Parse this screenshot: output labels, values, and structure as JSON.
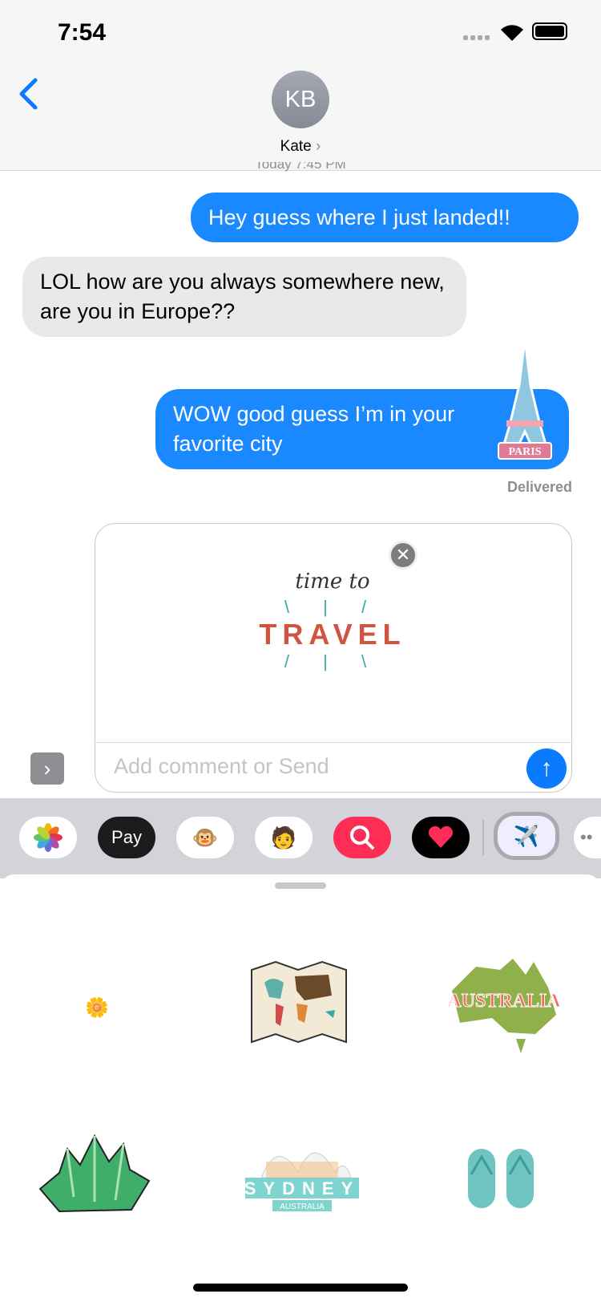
{
  "status": {
    "time": "7:54"
  },
  "header": {
    "avatar_initials": "KB",
    "contact_name": "Kate",
    "contact_chevron": "›"
  },
  "thread": {
    "timestamp": "Today 7:45 PM",
    "messages": [
      {
        "from": "me",
        "text": "Hey guess where I just landed!!"
      },
      {
        "from": "them",
        "text": "LOL how are you always somewhere new, are you in Europe??"
      },
      {
        "from": "me",
        "text": "WOW good guess I’m in your favorite city",
        "sticker": "PARIS"
      }
    ],
    "delivered": "Delivered"
  },
  "compose": {
    "sticker_line1": "time to",
    "sticker_line2": "TRAVEL",
    "placeholder": "Add comment or Send"
  },
  "apps": [
    "photos",
    "apple-pay",
    "animoji",
    "memoji",
    "image-search",
    "digital-touch",
    "travel-stickers",
    "more"
  ],
  "apps_labels": {
    "applepay": "Pay"
  },
  "stickers": {
    "australia": "AUSTRALIA",
    "sydney": "SYDNEY",
    "sydney_sub": "AUSTRALIA"
  },
  "colors": {
    "bubble_out": "#1a88fe",
    "bubble_in": "#e9e9eb",
    "accent": "#0a7aff"
  }
}
